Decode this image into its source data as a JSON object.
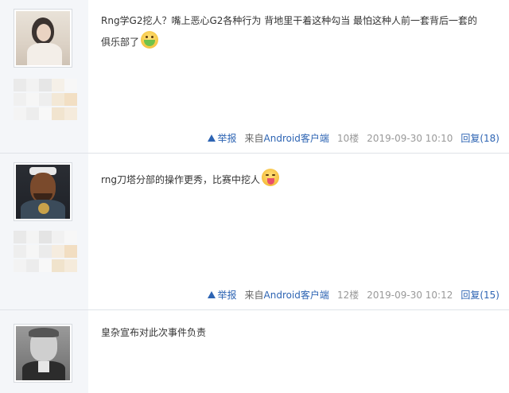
{
  "posts": [
    {
      "content_line1": "Rng学G2挖人？嘴上恶心G2各种行为 背地里干着这种勾当 最怕这种人前一套背后一套的",
      "content_line2": "俱乐部了",
      "emoji_icon": "sick-face-icon",
      "report_label": "举报",
      "client_prefix": "来自",
      "client_name": "Android客户端",
      "floor": "10楼",
      "time": "2019-09-30 10:10",
      "reply_label": "回复(18)"
    },
    {
      "content_line1": "rng刀塔分部的操作更秀，比赛中挖人",
      "emoji_icon": "tongue-out-face-icon",
      "report_label": "举报",
      "client_prefix": "来自",
      "client_name": "Android客户端",
      "floor": "12楼",
      "time": "2019-09-30 10:12",
      "reply_label": "回复(15)"
    },
    {
      "content_line1": "皇杂宣布对此次事件负责"
    }
  ],
  "colors": {
    "link": "#2d64b3",
    "sidebar": "#f4f6f9",
    "divider": "#dfe3e8"
  }
}
